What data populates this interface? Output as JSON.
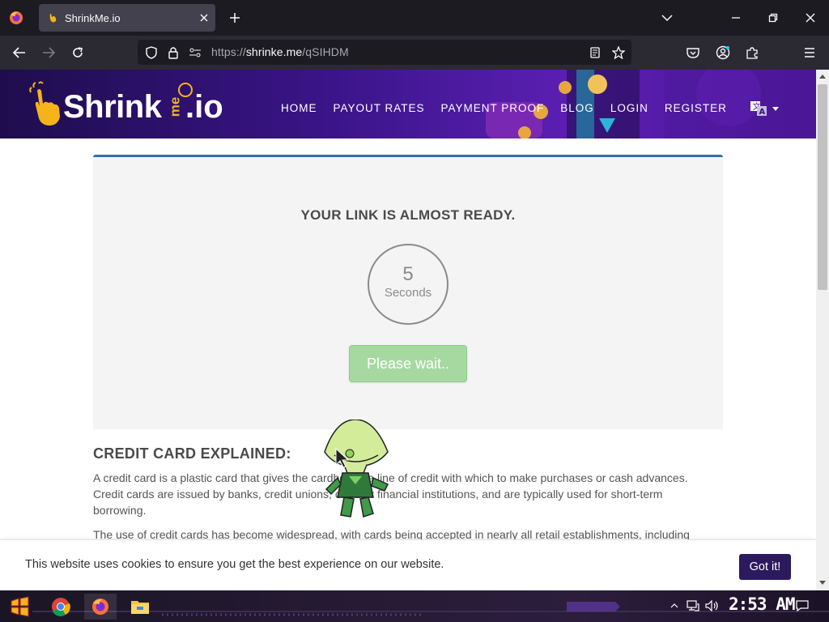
{
  "browser": {
    "tab_title": "ShrinkMe.io",
    "url_prefix": "https://",
    "url_host": "shrinke.me",
    "url_path": "/qSIHDM"
  },
  "site": {
    "logo_main": "Shrink",
    "logo_me": "me",
    "logo_io": ".io",
    "nav": [
      "HOME",
      "PAYOUT RATES",
      "PAYMENT PROOF",
      "BLOG",
      "LOGIN",
      "REGISTER"
    ],
    "language_icon": "translate-icon"
  },
  "card": {
    "title": "YOUR LINK IS ALMOST READY.",
    "countdown": "5",
    "countdown_unit": "Seconds",
    "button": "Please wait.."
  },
  "article": {
    "title": "CREDIT CARD EXPLAINED:",
    "p1_l1": "A credit card is a plastic card that gives the cardholder a line of credit with which to make purchases or cash advances.",
    "p1_l2": "Credit cards are issued by banks, credit unions, or other financial institutions, and are typically used for short-term",
    "p1_l3": "borrowing.",
    "p2_l1": "The use of credit cards has become widespread, with cards being accepted in nearly all retail establishments, including"
  },
  "cookie": {
    "text": "This website uses cookies to ensure you get the best experience on our website.",
    "button": "Got it!"
  },
  "taskbar": {
    "clock": "2:53 AM"
  },
  "colors": {
    "header_gradient_start": "#1e0d4d",
    "header_gradient_end": "#5b1fb3",
    "card_accent": "#2f6fb3",
    "wait_button": "#a5d9a0",
    "cookie_button": "#2b1a5e"
  }
}
